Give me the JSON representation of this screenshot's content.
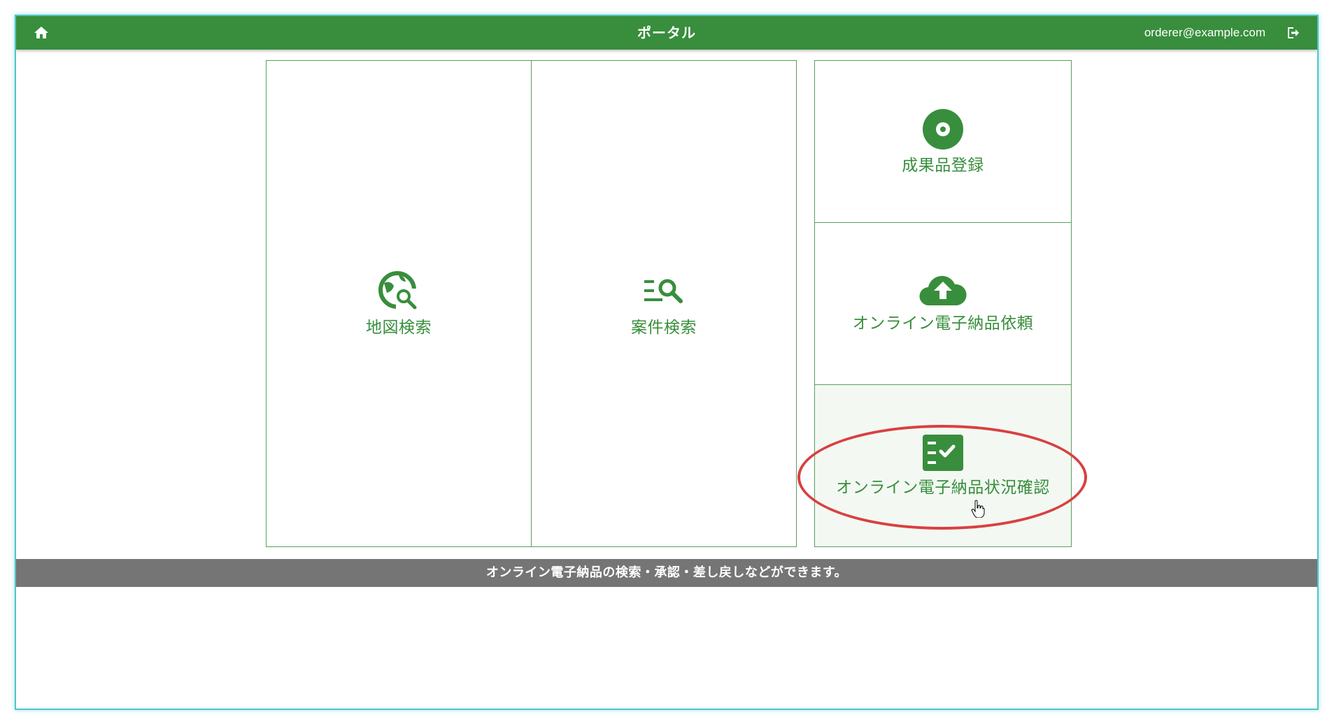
{
  "header": {
    "title": "ポータル",
    "user_email": "orderer@example.com",
    "home_icon": "home-icon",
    "logout_icon": "logout-icon"
  },
  "tiles": [
    {
      "label": "地図検索",
      "icon": "map-search-icon"
    },
    {
      "label": "案件検索",
      "icon": "list-search-icon"
    },
    {
      "label": "成果品登録",
      "icon": "disc-icon"
    },
    {
      "label": "オンライン電子納品依頼",
      "icon": "cloud-upload-icon"
    },
    {
      "label": "オンライン電子納品状況確認",
      "icon": "checklist-icon"
    }
  ],
  "footer": {
    "description": "オンライン電子納品の検索・承認・差し戻しなどができます。"
  },
  "colors": {
    "primary": "#388e3c",
    "footer_bg": "#757575",
    "highlight": "#d94040",
    "frame": "#4fc6c6"
  }
}
